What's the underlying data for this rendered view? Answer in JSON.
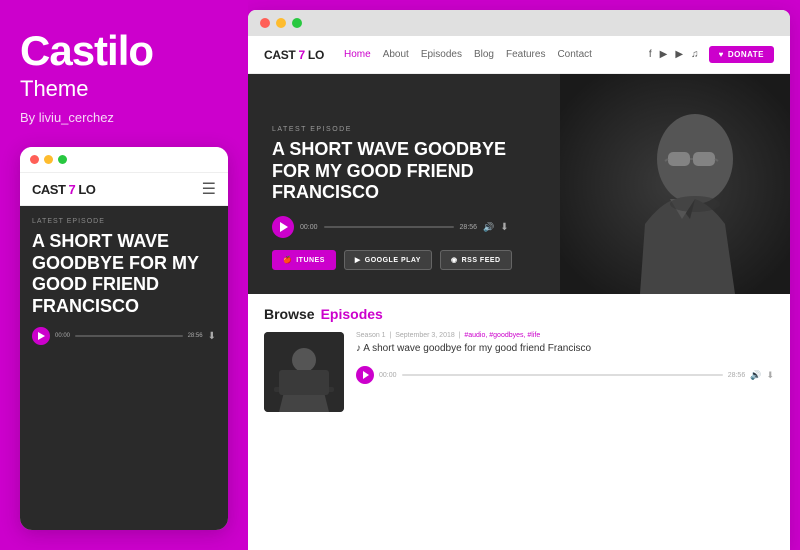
{
  "left": {
    "title": "Castilo",
    "subtitle": "Theme",
    "author": "By liviu_cerchez",
    "mobile": {
      "logo_text": "CAST",
      "logo_accent": "7",
      "logo_suffix": "LO",
      "latest_label": "LATEST EPISODE",
      "episode_title": "A SHORT WAVE GOODBYE FOR MY GOOD FRIEND FRANCISCO",
      "time_start": "00:00",
      "time_end": "28:56"
    }
  },
  "right": {
    "titlebar": {
      "dots": [
        "#ff5f57",
        "#febc2e",
        "#28c840"
      ]
    },
    "nav": {
      "logo_text": "CAST",
      "logo_accent": "7",
      "logo_suffix": "LO",
      "links": [
        "Home",
        "About",
        "Episodes",
        "Blog",
        "Features",
        "Contact"
      ],
      "active_link": "Home",
      "donate_label": "DONATE"
    },
    "hero": {
      "latest_label": "LATEST EPISODE",
      "episode_title": "A SHORT WAVE GOODBYE FOR MY GOOD FRIEND FRANCISCO",
      "time_start": "00:00",
      "time_end": "28:56",
      "buttons": [
        "ITUNES",
        "GOOGLE PLAY",
        "RSS FEED"
      ]
    },
    "browse": {
      "title": "Browse",
      "episodes_label": "Episodes",
      "episode": {
        "season": "Season 1",
        "date": "September 3, 2018",
        "tags": "#audio, #goodbyes, #life",
        "title": "♪ A short wave goodbye for my good friend Francisco",
        "time_start": "00:00",
        "time_end": "28:56"
      }
    }
  },
  "colors": {
    "magenta": "#cc00cc",
    "dark_bg": "#2a2a2a",
    "light_bg": "#fff"
  }
}
